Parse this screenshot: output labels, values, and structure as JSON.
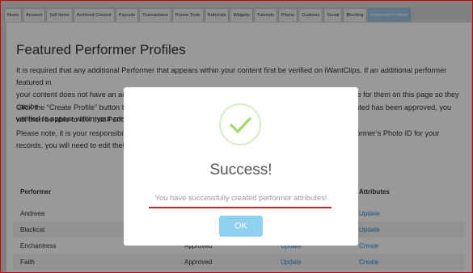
{
  "tabs": [
    "News",
    "Account",
    "Sell Items",
    "Archived Content",
    "Payouts",
    "Transactions",
    "Promo Tools",
    "Referrals",
    "Widgets",
    "Tutorials",
    "Phone",
    "Customs",
    "Social",
    "Blocking",
    "Performer Profiles"
  ],
  "active_tab": "Performer Profiles",
  "page": {
    "title": "Featured Performer Profiles",
    "para1_lines": [
      "It is required that any additional Performer that appears within your content first be verified on iWantClips. If an additional performer featured in",
      "your content does not have an active iWantClips account, you will need to create a new Performer Profile for them on this page so they can be",
      "verified to appear within your content"
    ],
    "para2_lines": [
      "Click the “Create Profile” button to c",
      "will then be able to link that Perform"
    ],
    "para2_right_lines": [
      "eated has been approved, you"
    ],
    "para3_lines": [
      "Please note, it is your responsibility",
      "records, you will need to edit their e"
    ],
    "para3_right_lines": [
      "former’s Photo ID for your"
    ]
  },
  "table": {
    "headers": {
      "performer": "Performer",
      "attributes": "Attributes"
    },
    "rows": [
      {
        "performer": "Andreea",
        "status": "",
        "profile_action": "",
        "attributes_action": "Update"
      },
      {
        "performer": "Blackcat",
        "status": "",
        "profile_action": "",
        "attributes_action": "Update"
      },
      {
        "performer": "Enchantress",
        "status": "Approved",
        "profile_action": "Update",
        "attributes_action": "Create"
      },
      {
        "performer": "Faith",
        "status": "Approved",
        "profile_action": "Update",
        "attributes_action": "Create"
      }
    ]
  },
  "modal": {
    "title": "Success!",
    "message": "You have successfully created performer attributes!",
    "ok_label": "OK",
    "check_icon": "check-icon"
  },
  "colors": {
    "accent": "#8fd0ee",
    "link": "#3a8fd0",
    "success": "#a5d86e",
    "highlight": "#d42020"
  }
}
